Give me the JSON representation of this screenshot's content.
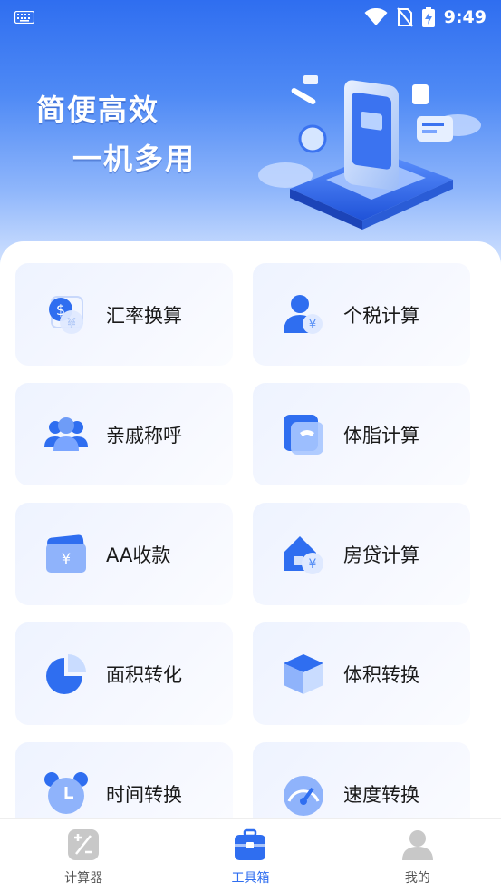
{
  "status_bar": {
    "time": "9:49"
  },
  "banner": {
    "slogan_line1": "简便高效",
    "slogan_line2": "一机多用"
  },
  "tools": [
    {
      "label": "汇率换算",
      "icon": "currency-exchange-icon"
    },
    {
      "label": "个税计算",
      "icon": "income-tax-icon"
    },
    {
      "label": "亲戚称呼",
      "icon": "relatives-icon"
    },
    {
      "label": "体脂计算",
      "icon": "body-fat-scale-icon"
    },
    {
      "label": "AA收款",
      "icon": "aa-payment-icon"
    },
    {
      "label": "房贷计算",
      "icon": "mortgage-house-icon"
    },
    {
      "label": "面积转化",
      "icon": "area-pie-icon"
    },
    {
      "label": "体积转换",
      "icon": "volume-cube-icon"
    },
    {
      "label": "时间转换",
      "icon": "alarm-clock-icon"
    },
    {
      "label": "速度转换",
      "icon": "speedometer-icon"
    }
  ],
  "tabbar": {
    "items": [
      {
        "label": "计算器",
        "icon": "calculator-icon",
        "active": false
      },
      {
        "label": "工具箱",
        "icon": "toolbox-icon",
        "active": true
      },
      {
        "label": "我的",
        "icon": "profile-icon",
        "active": false
      }
    ]
  },
  "colors": {
    "accent": "#2f6ef0",
    "card_bg": "#eef3ff",
    "text": "#1a1a1a",
    "inactive": "#555555"
  }
}
